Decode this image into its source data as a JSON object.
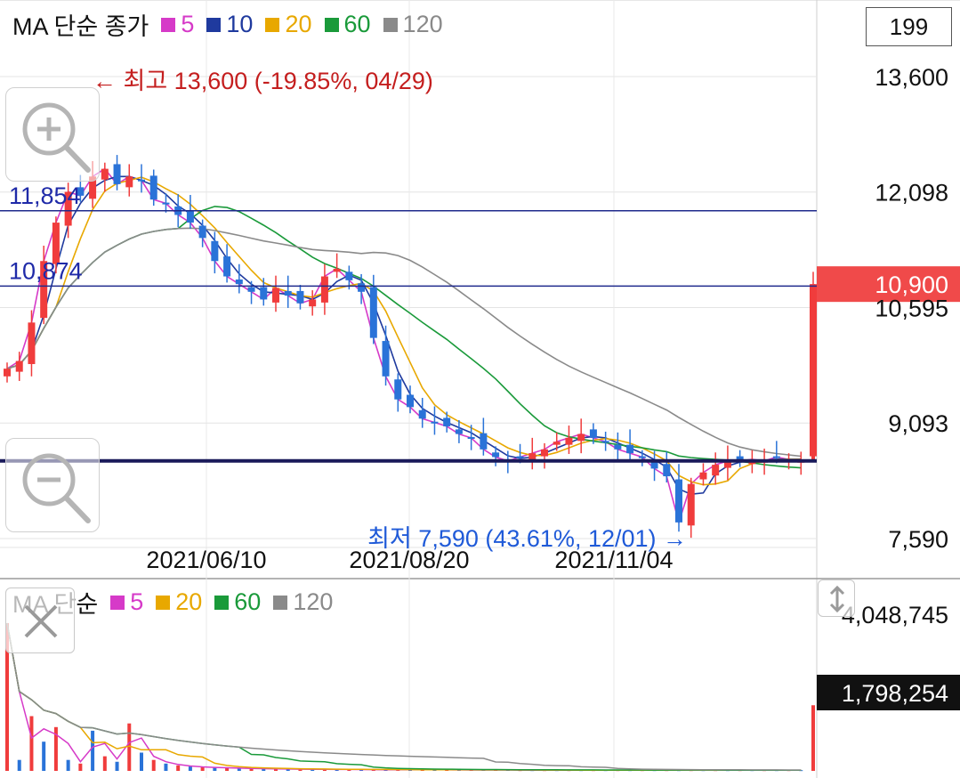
{
  "price_legend": {
    "title": "MA 단순 종가",
    "items": [
      {
        "label": "5",
        "color": "#d63ac8"
      },
      {
        "label": "10",
        "color": "#1f3a9e"
      },
      {
        "label": "20",
        "color": "#e8a800"
      },
      {
        "label": "60",
        "color": "#1a9a3a"
      },
      {
        "label": "120",
        "color": "#8a8a8a"
      }
    ]
  },
  "volume_legend": {
    "title": "MA 단순",
    "items": [
      {
        "label": "5",
        "color": "#d63ac8"
      },
      {
        "label": "20",
        "color": "#e8a800"
      },
      {
        "label": "60",
        "color": "#1a9a3a"
      },
      {
        "label": "120",
        "color": "#8a8a8a"
      }
    ]
  },
  "period_value": "199",
  "colors": {
    "up": "#f03c3c",
    "down": "#2a73d8",
    "hline": "#1f2a8c",
    "support": "#1a1a5a",
    "current_price_bg": "#f04a4a",
    "volume_badge_bg": "#111111"
  },
  "chart_data": [
    {
      "type": "candlestick",
      "title": "",
      "y_axis_ticks": [
        "13,600",
        "12,098",
        "10,595",
        "9,093",
        "7,590"
      ],
      "y_axis_values": [
        13600,
        12098,
        10595,
        9093,
        7590
      ],
      "ylim": [
        7590,
        13600
      ],
      "x_axis_ticks": [
        "2021/06/10",
        "2021/08/20",
        "2021/11/04"
      ],
      "annotations": {
        "high": "← 최고 13,600 (-19.85%, 04/29)",
        "low": "최저 7,590 (43.61%, 12/01) →",
        "hlines": [
          {
            "label": "11,854",
            "value": 11854
          },
          {
            "label": "10,874",
            "value": 10874
          }
        ],
        "support_line": 8600,
        "current_price": "10,900"
      },
      "close_approx": [
        9800,
        9900,
        10400,
        11200,
        11700,
        12100,
        12050,
        12300,
        12400,
        12200,
        12300,
        12250,
        12000,
        11950,
        11800,
        11700,
        11500,
        11200,
        11000,
        10900,
        10800,
        10700,
        10850,
        10750,
        10650,
        10700,
        11000,
        11100,
        10950,
        10800,
        10200,
        9700,
        9400,
        9300,
        9150,
        9100,
        9050,
        8950,
        8900,
        8750,
        8650,
        8600,
        8650,
        8700,
        8750,
        8850,
        8900,
        8950,
        8900,
        8850,
        8750,
        8700,
        8650,
        8500,
        8400,
        7800,
        8300,
        8450,
        8550,
        8600,
        8600,
        8620,
        8600,
        8650,
        8620,
        8600,
        10900
      ],
      "ma_series": [
        "5",
        "10",
        "20",
        "60",
        "120"
      ]
    },
    {
      "type": "bar",
      "title": "",
      "y_axis_ticks": [
        "4,048,745"
      ],
      "current_volume": "1,798,254",
      "values_approx": [
        4048745,
        300000,
        1500000,
        800000,
        1200000,
        300000,
        200000,
        1100000,
        400000,
        250000,
        1300000,
        500000,
        300000,
        200000,
        150000,
        120000,
        100000,
        90000,
        80000,
        70000,
        60000,
        60000,
        50000,
        50000,
        45000,
        45000,
        40000,
        40000,
        40000,
        35000,
        35000,
        30000,
        30000,
        30000,
        30000,
        30000,
        30000,
        25000,
        25000,
        25000,
        25000,
        25000,
        20000,
        20000,
        20000,
        20000,
        20000,
        20000,
        20000,
        20000,
        20000,
        20000,
        20000,
        20000,
        20000,
        20000,
        20000,
        20000,
        20000,
        20000,
        20000,
        20000,
        20000,
        20000,
        20000,
        20000,
        1798254
      ],
      "ma_series": [
        "5",
        "20",
        "60",
        "120"
      ]
    }
  ]
}
